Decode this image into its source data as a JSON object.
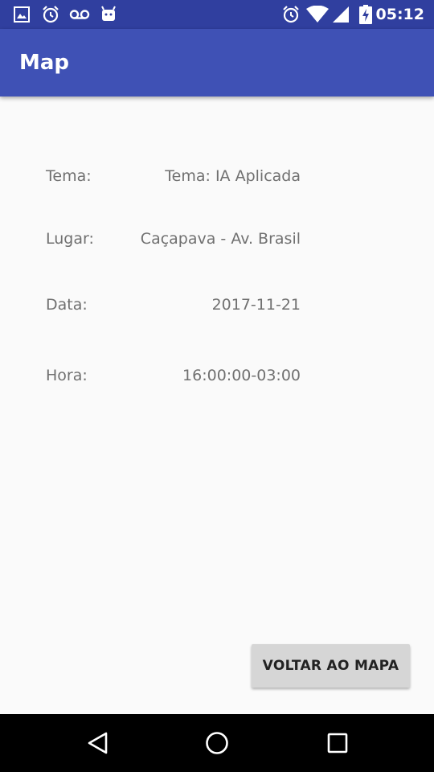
{
  "status_bar": {
    "time": "05:12",
    "left_icons": [
      "image-icon",
      "alarm-icon",
      "voicemail-icon",
      "android-icon"
    ],
    "right_icons": [
      "alarm-icon",
      "wifi-icon",
      "signal-icon",
      "battery-charging-icon"
    ]
  },
  "app_bar": {
    "title": "Map"
  },
  "details": {
    "tema": {
      "label": "Tema:",
      "value": "Tema: IA Aplicada"
    },
    "lugar": {
      "label": "Lugar:",
      "value": "Caçapava - Av. Brasil"
    },
    "data": {
      "label": "Data:",
      "value": "2017-11-21"
    },
    "hora": {
      "label": "Hora:",
      "value": "16:00:00-03:00"
    }
  },
  "actions": {
    "back_label": "VOLTAR AO MAPA"
  },
  "nav_bar": {
    "icons": [
      "back-icon",
      "home-icon",
      "recents-icon"
    ]
  },
  "colors": {
    "status_bar": "#303f9f",
    "app_bar": "#3f51b5",
    "background": "#fafafa",
    "button": "#d6d6d6"
  }
}
